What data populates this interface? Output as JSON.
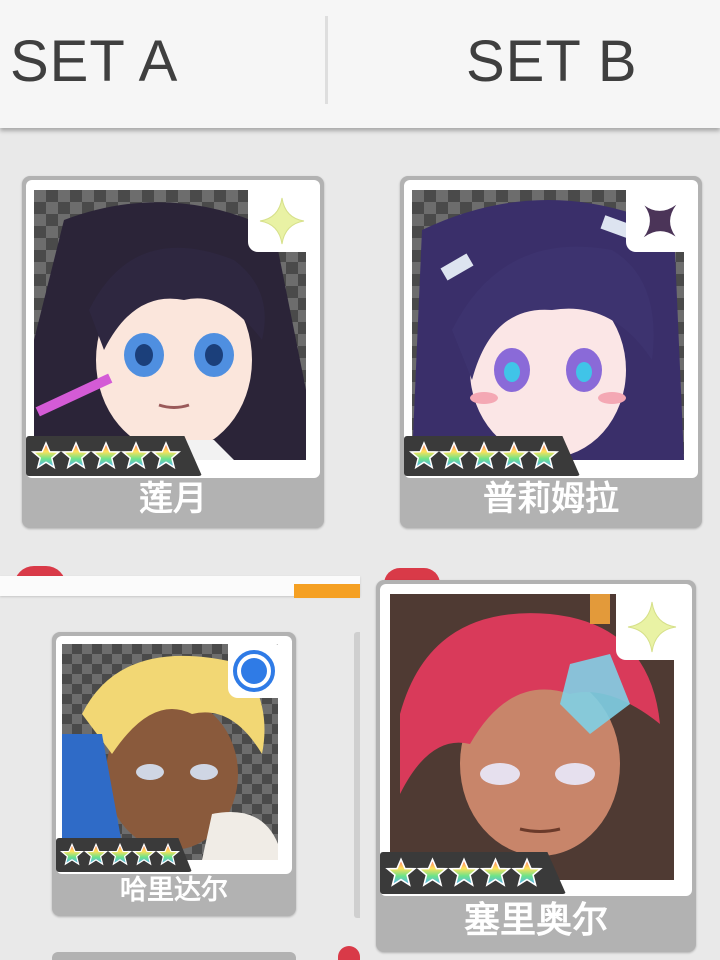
{
  "header": {
    "tabs": [
      {
        "label": "SET A"
      },
      {
        "label": "SET B"
      }
    ]
  },
  "cards": [
    {
      "name": "莲月",
      "stars": 5,
      "badge_icon": "sparkle-icon",
      "badge_color": "#e9f2a4"
    },
    {
      "name": "普莉姆拉",
      "stars": 5,
      "badge_icon": "dark-sparkle-icon",
      "badge_color": "#4b3458"
    },
    {
      "name": "哈里达尔",
      "stars": 5,
      "badge_icon": "blue-circle-icon",
      "badge_color": "#2f7be6"
    },
    {
      "name": "塞里奥尔",
      "stars": 5,
      "badge_icon": "sparkle-icon",
      "badge_color": "#e9f2a4"
    }
  ],
  "colors": {
    "accent_orange": "#f5a023",
    "notification_red": "#d93a48",
    "card_gray": "#b2b2b2"
  },
  "star_glyph": "★★★★★"
}
